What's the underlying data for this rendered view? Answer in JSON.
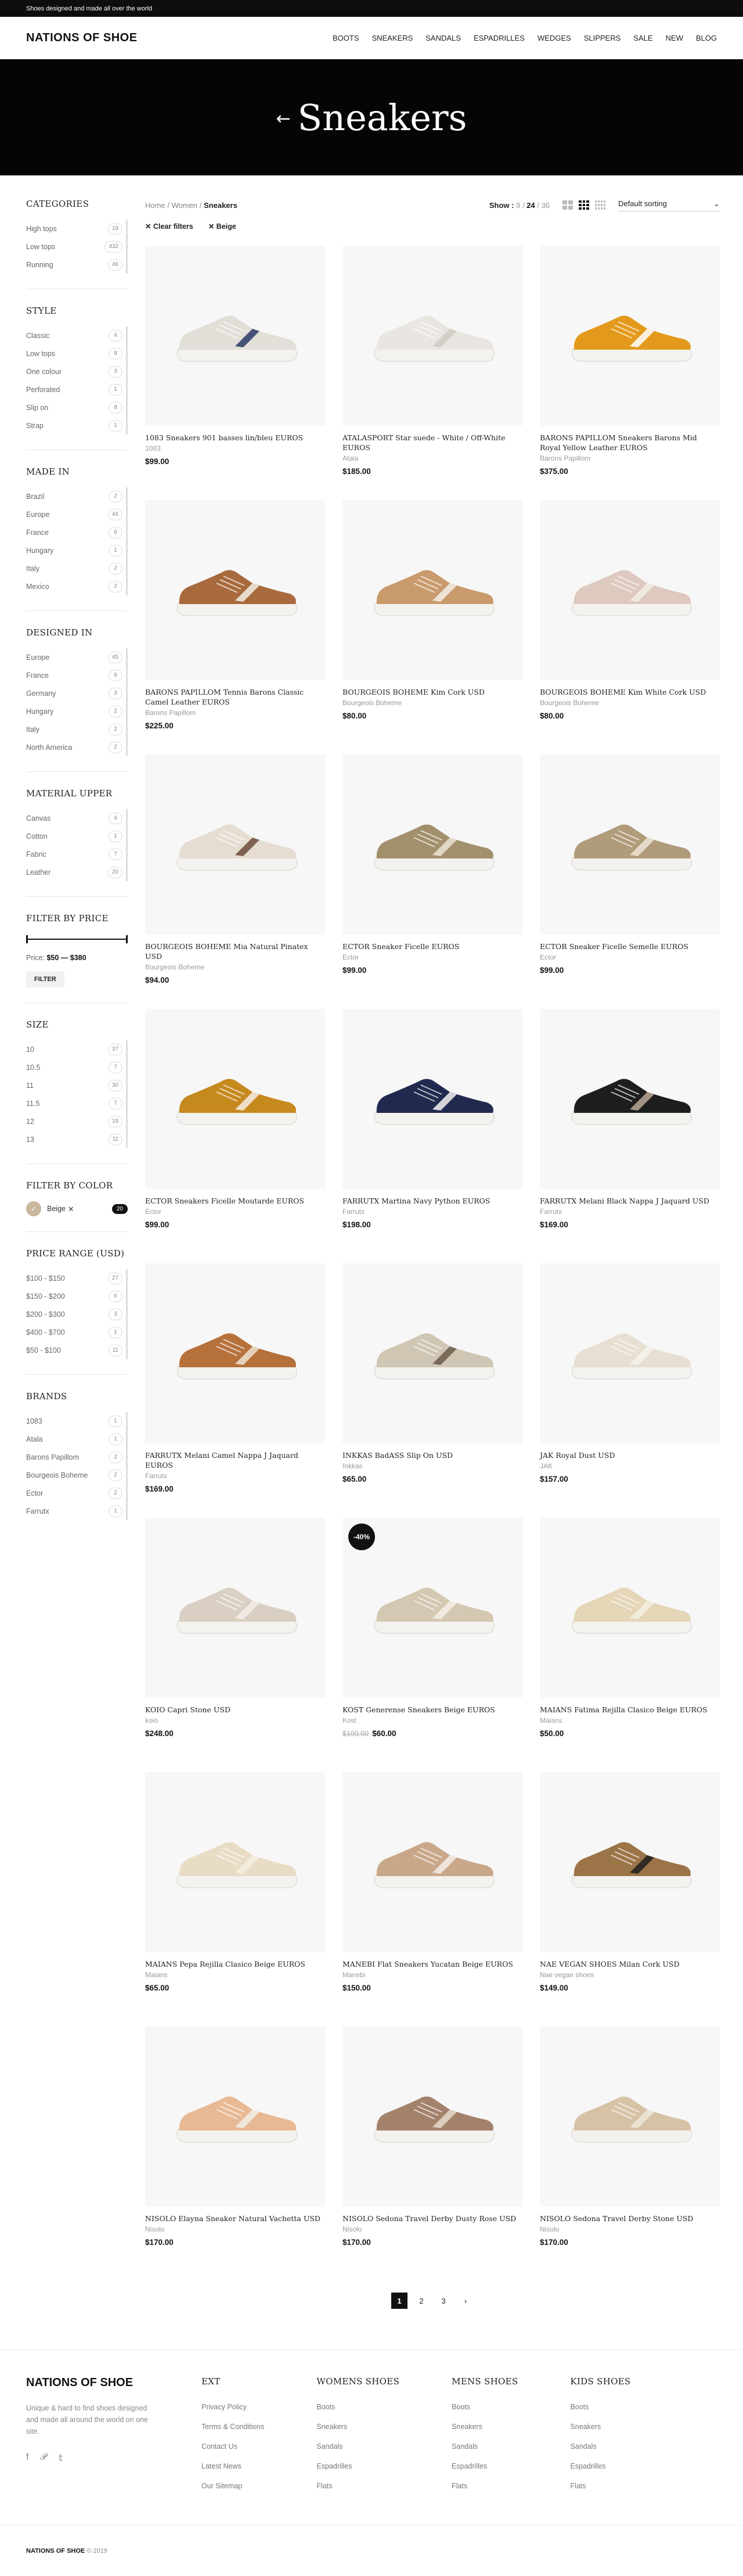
{
  "topbar": {
    "text": "Shoes designed and made all over the world"
  },
  "header": {
    "logo": "NATIONS OF SHOE",
    "nav": [
      "BOOTS",
      "SNEAKERS",
      "SANDALS",
      "ESPADRILLES",
      "WEDGES",
      "SLIPPERS",
      "SALE",
      "NEW",
      "BLOG"
    ]
  },
  "hero": {
    "arrow": "←",
    "title": "Sneakers"
  },
  "sidebar": {
    "categories": {
      "title": "CATEGORIES",
      "items": [
        [
          "High tops",
          "19"
        ],
        [
          "Low tops",
          "432"
        ],
        [
          "Running",
          "46"
        ]
      ]
    },
    "style": {
      "title": "STYLE",
      "items": [
        [
          "Classic",
          "4"
        ],
        [
          "Low tops",
          "8"
        ],
        [
          "One colour",
          "3"
        ],
        [
          "Perforated",
          "1"
        ],
        [
          "Slip on",
          "8"
        ],
        [
          "Strap",
          "1"
        ]
      ]
    },
    "made_in": {
      "title": "MADE IN",
      "items": [
        [
          "Brazil",
          "2"
        ],
        [
          "Europe",
          "44"
        ],
        [
          "France",
          "6"
        ],
        [
          "Hungary",
          "1"
        ],
        [
          "Italy",
          "2"
        ],
        [
          "Mexico",
          "2"
        ]
      ]
    },
    "designed_in": {
      "title": "DESIGNED IN",
      "items": [
        [
          "Europe",
          "45"
        ],
        [
          "France",
          "6"
        ],
        [
          "Germany",
          "3"
        ],
        [
          "Hungary",
          "2"
        ],
        [
          "Italy",
          "2"
        ],
        [
          "North America",
          "2"
        ]
      ]
    },
    "material": {
      "title": "MATERIAL UPPER",
      "items": [
        [
          "Canvas",
          "4"
        ],
        [
          "Cotton",
          "1"
        ],
        [
          "Fabric",
          "7"
        ],
        [
          "Leather",
          "20"
        ]
      ]
    },
    "price": {
      "title": "FILTER BY PRICE",
      "label": "Price:",
      "range": "$50 — $380",
      "button": "FILTER"
    },
    "size": {
      "title": "SIZE",
      "items": [
        [
          "10",
          "37"
        ],
        [
          "10.5",
          "7"
        ],
        [
          "11",
          "30"
        ],
        [
          "11.5",
          "7"
        ],
        [
          "12",
          "19"
        ],
        [
          "13",
          "11"
        ]
      ]
    },
    "color": {
      "title": "FILTER BY COLOR",
      "name": "Beige",
      "remove": "✕",
      "count": "20",
      "check": "✓"
    },
    "price_range": {
      "title": "PRICE RANGE (USD)",
      "items": [
        [
          "$100 - $150",
          "27"
        ],
        [
          "$150 - $200",
          "6"
        ],
        [
          "$200 - $300",
          "3"
        ],
        [
          "$400 - $700",
          "1"
        ],
        [
          "$50 - $100",
          "11"
        ]
      ]
    },
    "brands": {
      "title": "BRANDS",
      "items": [
        [
          "1083",
          "1"
        ],
        [
          "Atala",
          "1"
        ],
        [
          "Barons Papillom",
          "2"
        ],
        [
          "Bourgeois Boheme",
          "2"
        ],
        [
          "Ector",
          "2"
        ],
        [
          "Farrutx",
          "1"
        ]
      ]
    }
  },
  "toolbar": {
    "breadcrumbs": [
      "Home",
      "Women",
      "Sneakers"
    ],
    "sep": "/",
    "show_label": "Show :",
    "show_options": [
      "9",
      "24",
      "36"
    ],
    "sort_label": "Default sorting",
    "sort_caret": "⌄"
  },
  "chips": [
    "✕  Clear filters",
    "✕  Beige"
  ],
  "products": [
    {
      "name": "1083 Sneakers 901 basses lin/bleu EUROS",
      "brand": "1083",
      "price": "$99.00",
      "color": "#e2dfd8",
      "accent": "#2c3a66"
    },
    {
      "name": "ATALASPORT Star suede - White / Off-White EUROS",
      "brand": "Atala",
      "price": "$185.00",
      "color": "#e9e6e1",
      "accent": "#cfcac2"
    },
    {
      "name": "BARONS PAPILLOM Sneakers Barons Mid Royal Yellow Leather EUROS",
      "brand": "Barons Papillom",
      "price": "$375.00",
      "color": "#e39a1c",
      "accent": "#ffffff"
    },
    {
      "name": "BARONS PAPILLOM Tennis Barons Classic Camel Leather EUROS",
      "brand": "Barons Papillom",
      "price": "$225.00",
      "color": "#a86a3d",
      "accent": "#f2efe8"
    },
    {
      "name": "BOURGEOIS BOHEME Kim Cork USD",
      "brand": "Bourgeois Boheme",
      "price": "$80.00",
      "color": "#c99a6c",
      "accent": "#f2efe8"
    },
    {
      "name": "BOURGEOIS BOHEME Kim White Cork USD",
      "brand": "Bourgeois Boheme",
      "price": "$80.00",
      "color": "#ddc9bd",
      "accent": "#f2efe8"
    },
    {
      "name": "BOURGEOIS BOHEME Mia Natural Pinatex USD",
      "brand": "Bourgeois Boheme",
      "price": "$94.00",
      "color": "#e6ddd2",
      "accent": "#6a4b3a"
    },
    {
      "name": "ECTOR Sneaker Ficelle EUROS",
      "brand": "Ector",
      "price": "$99.00",
      "color": "#a2906d",
      "accent": "#efe5d6"
    },
    {
      "name": "ECTOR Sneaker Ficelle Semelle EUROS",
      "brand": "Ector",
      "price": "$99.00",
      "color": "#b09b7a",
      "accent": "#efe5d6"
    },
    {
      "name": "ECTOR Sneakers Ficelle Moutarde EUROS",
      "brand": "Ector",
      "price": "$99.00",
      "color": "#c6891e",
      "accent": "#f4efe6"
    },
    {
      "name": "FARRUTX Martina Navy Python EUROS",
      "brand": "Farrutx",
      "price": "$198.00",
      "color": "#212a4e",
      "accent": "#f2f2f2"
    },
    {
      "name": "FARRUTX Melani Black Nappa J Jaquard USD",
      "brand": "Farrutx",
      "price": "$169.00",
      "color": "#1e1e1e",
      "accent": "#b8a998"
    },
    {
      "name": "FARRUTX Melani Camel Nappa J Jaquard EUROS",
      "brand": "Farrutx",
      "price": "$169.00",
      "color": "#b6703a",
      "accent": "#efe2cf"
    },
    {
      "name": "INKKAS BadASS Slip On USD",
      "brand": "Inkkas",
      "price": "$65.00",
      "color": "#cfc6b4",
      "accent": "#6b5b4b"
    },
    {
      "name": "JAK Royal Dust USD",
      "brand": "JAK",
      "price": "$157.00",
      "color": "#e7e0d2",
      "accent": "#f6f3ee"
    },
    {
      "name": "KOIO Capri Stone USD",
      "brand": "koio",
      "price": "$248.00",
      "color": "#d9cfc2",
      "accent": "#f3efe8"
    },
    {
      "name": "KOST Generense Sneakers Beige EUROS",
      "brand": "Kost",
      "price": "$60.00",
      "old_price": "$100.00",
      "badge": "-40%",
      "color": "#d4c8b2",
      "accent": "#f3efe8"
    },
    {
      "name": "MAIANS Fatima Rejilla Clasico Beige EUROS",
      "brand": "Maians",
      "price": "$50.00",
      "color": "#e4d6b7",
      "accent": "#f6f0e3"
    },
    {
      "name": "MAIANS Pepa Rejilla Clasico Beige EUROS",
      "brand": "Maians",
      "price": "$65.00",
      "color": "#e8dcc4",
      "accent": "#f6f0e3"
    },
    {
      "name": "MANEBI Flat Sneakers Yucatan Beige EUROS",
      "brand": "Manebi",
      "price": "$150.00",
      "color": "#c9a88a",
      "accent": "#f3efe8"
    },
    {
      "name": "NAE VEGAN SHOES Milan Cork USD",
      "brand": "Nae vegan shoes",
      "price": "$149.00",
      "color": "#9b7447",
      "accent": "#1e1e1e"
    },
    {
      "name": "NISOLO Elayna Sneaker Natural Vachetta USD",
      "brand": "Nisolo",
      "price": "$170.00",
      "color": "#e8b995",
      "accent": "#f3efe8"
    },
    {
      "name": "NISOLO Sedona Travel Derby Dusty Rose USD",
      "brand": "Nisolo",
      "price": "$170.00",
      "color": "#a3826b",
      "accent": "#e6dacb"
    },
    {
      "name": "NISOLO Sedona Travel Derby Stone USD",
      "brand": "Nisolo",
      "price": "$170.00",
      "color": "#d6c2a6",
      "accent": "#efe6d8"
    }
  ],
  "pagination": [
    "1",
    "2",
    "3",
    "›"
  ],
  "footer": {
    "brand": "NATIONS OF SHOE",
    "desc": "Unique & hard to find shoes designed and made all around the world on one site.",
    "social": [
      "f",
      "𝒫",
      "𝕥"
    ],
    "cols": [
      {
        "title": "EXT",
        "links": [
          "Privacy Policy",
          "Terms & Conditions",
          "Contact Us",
          "Latest News",
          "Our Sitemap"
        ]
      },
      {
        "title": "WOMENS SHOES",
        "links": [
          "Boots",
          "Sneakers",
          "Sandals",
          "Espadrilles",
          "Flats"
        ]
      },
      {
        "title": "MENS SHOES",
        "links": [
          "Boots",
          "Sneakers",
          "Sandals",
          "Espadrilles",
          "Flats"
        ]
      },
      {
        "title": "KIDS SHOES",
        "links": [
          "Boots",
          "Sneakers",
          "Sandals",
          "Espadrilles",
          "Flats"
        ]
      }
    ],
    "copyright_brand": "NATIONS OF SHOE",
    "copyright_year": "© 2019"
  }
}
